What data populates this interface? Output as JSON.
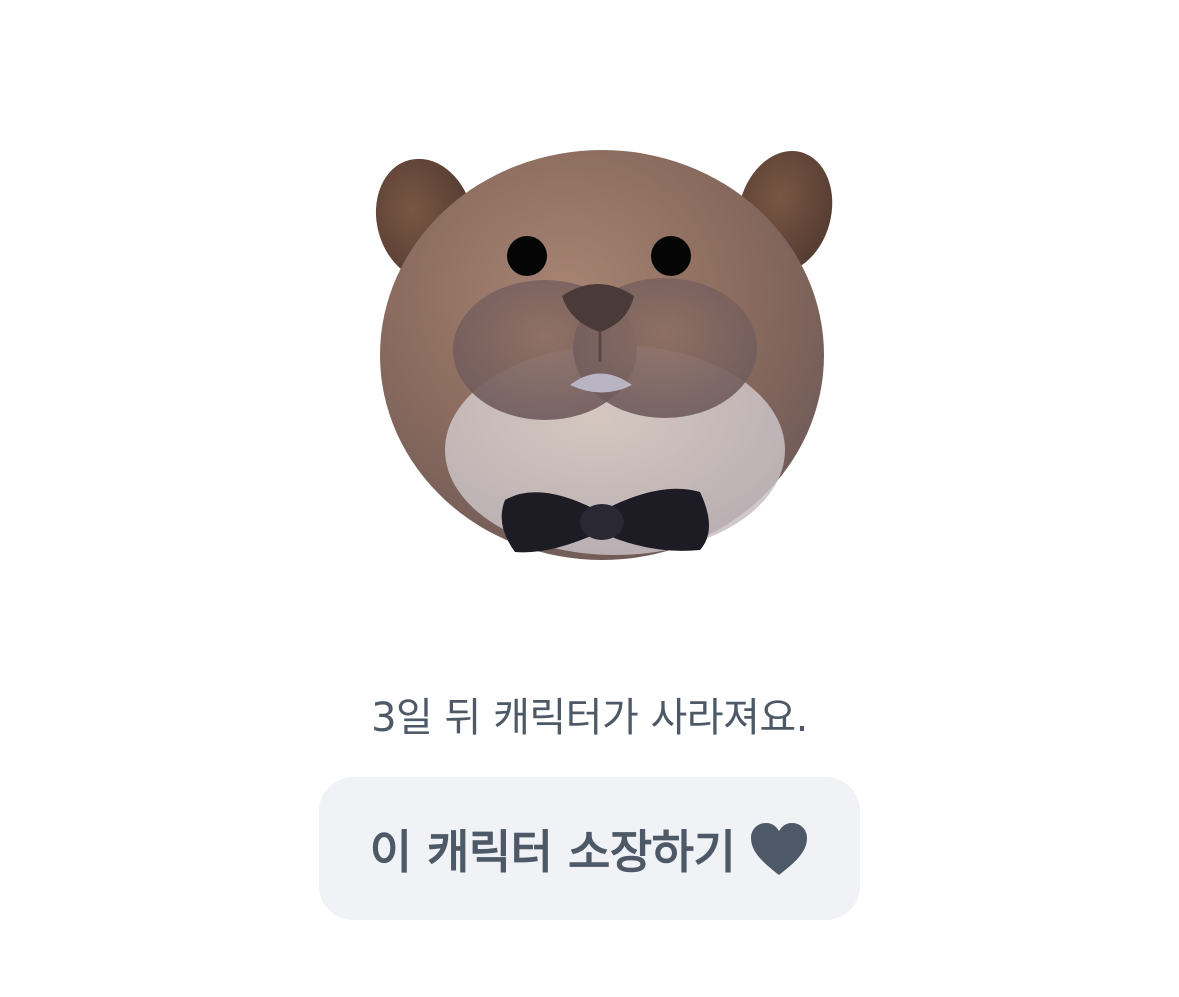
{
  "character": {
    "icon": "otter-character-icon",
    "colors": {
      "fur": "#8e6e5e",
      "ear": "#6b4a3a",
      "muzzle": "#d8ccc6",
      "bowtie": "#1d1b24"
    }
  },
  "notice": {
    "text": "3일 뒤 캐릭터가 사라져요."
  },
  "own_button": {
    "label": "이 캐릭터 소장하기",
    "icon": "heart-icon",
    "background": "#f0f2f5",
    "text_color": "#4e5968"
  }
}
